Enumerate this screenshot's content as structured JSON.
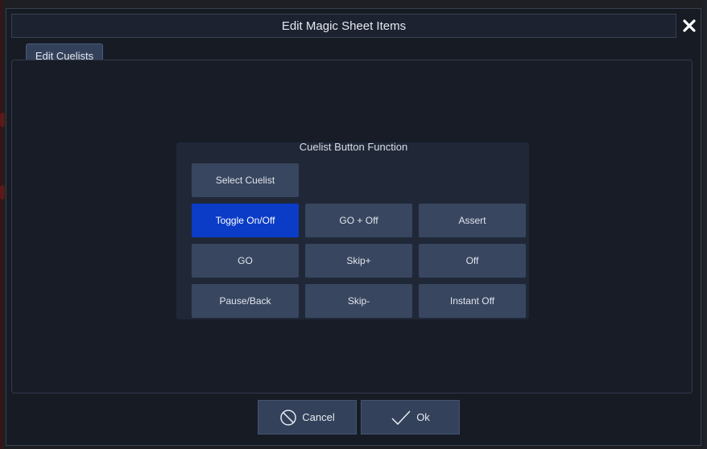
{
  "dialog": {
    "title": "Edit Magic Sheet Items",
    "close_icon": "close-icon"
  },
  "tabs": [
    {
      "label": "Edit Cuelists"
    }
  ],
  "group": {
    "title": "Cuelist Button Function",
    "buttons": [
      {
        "label": "Select Cuelist",
        "active": false
      },
      {
        "label": "Toggle On/Off",
        "active": true
      },
      {
        "label": "GO + Off",
        "active": false
      },
      {
        "label": "Assert",
        "active": false
      },
      {
        "label": "GO",
        "active": false
      },
      {
        "label": "Skip+",
        "active": false
      },
      {
        "label": "Off",
        "active": false
      },
      {
        "label": "Pause/Back",
        "active": false
      },
      {
        "label": "Skip-",
        "active": false
      },
      {
        "label": "Instant Off",
        "active": false
      }
    ]
  },
  "footer": {
    "cancel_label": "Cancel",
    "cancel_icon": "cancel-circle-icon",
    "ok_label": "Ok",
    "ok_icon": "checkmark-icon"
  },
  "colors": {
    "active_button": "#0a3cc8",
    "button": "#38465f",
    "dialog_bg": "#161b24"
  }
}
